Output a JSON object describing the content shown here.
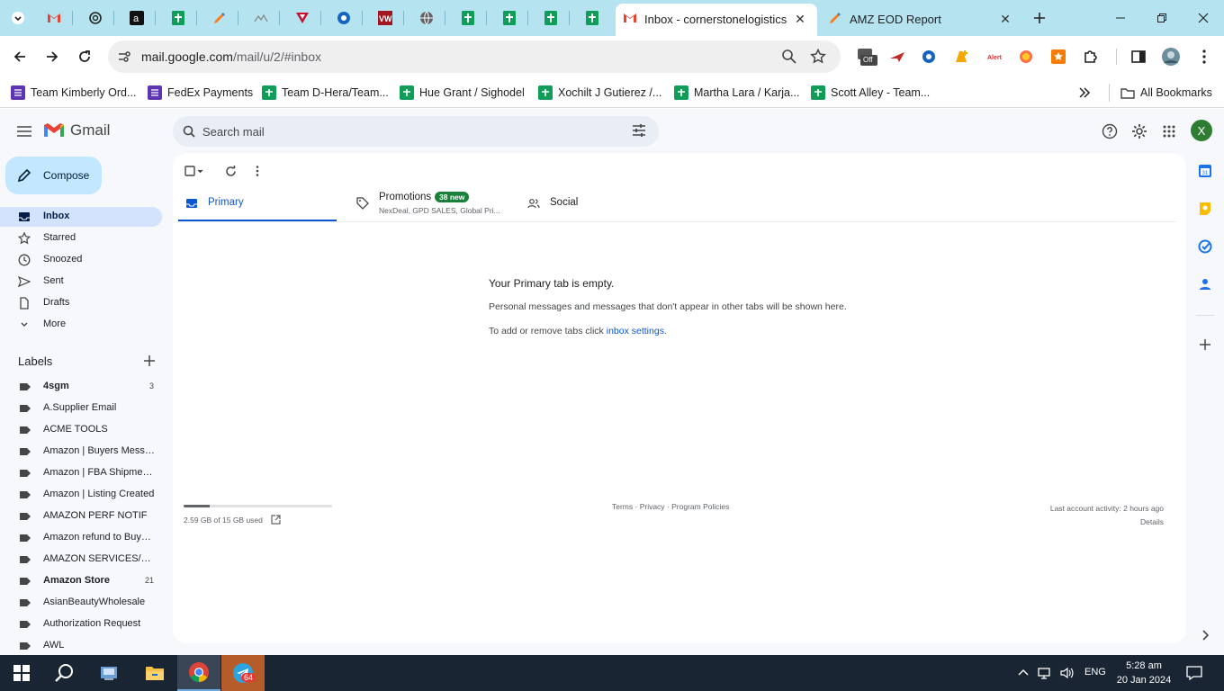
{
  "browser": {
    "active_tab_title": "Inbox - cornerstonelogisticsllc",
    "second_tab_title": "AMZ EOD Report",
    "url_host": "mail.google.com",
    "url_path": "/mail/u/2/#inbox",
    "bookmarks": [
      "Team Kimberly Ord...",
      "FedEx Payments",
      "Team D-Hera/Team...",
      "Hue Grant / Sighodel",
      "Xochilt J Gutierez /...",
      "Martha Lara / Karja...",
      "Scott Alley - Team..."
    ],
    "all_bookmarks": "All Bookmarks",
    "ext_off_label": "Off"
  },
  "gmail": {
    "logo_text": "Gmail",
    "search_placeholder": "Search mail",
    "avatar_letter": "X",
    "compose_label": "Compose",
    "nav": [
      "Inbox",
      "Starred",
      "Snoozed",
      "Sent",
      "Drafts",
      "More"
    ],
    "labels_heading": "Labels",
    "labels": [
      {
        "name": "4sgm",
        "count": "3",
        "bold": true
      },
      {
        "name": "A.Supplier Email",
        "count": "",
        "bold": false
      },
      {
        "name": "ACME TOOLS",
        "count": "",
        "bold": false
      },
      {
        "name": "Amazon | Buyers Messa...",
        "count": "",
        "bold": false
      },
      {
        "name": "Amazon | FBA Shipments",
        "count": "",
        "bold": false
      },
      {
        "name": "Amazon | Listing Created",
        "count": "",
        "bold": false
      },
      {
        "name": "AMAZON PERF NOTIF",
        "count": "",
        "bold": false
      },
      {
        "name": "Amazon refund to Buyers",
        "count": "",
        "bold": false
      },
      {
        "name": "AMAZON SERVICES/PAY...",
        "count": "",
        "bold": false
      },
      {
        "name": "Amazon Store",
        "count": "21",
        "bold": true
      },
      {
        "name": "AsianBeautyWholesale",
        "count": "",
        "bold": false
      },
      {
        "name": "Authorization Request",
        "count": "",
        "bold": false
      },
      {
        "name": "AWL",
        "count": "",
        "bold": false
      }
    ],
    "tabs": {
      "primary": "Primary",
      "promotions": "Promotions",
      "promotions_badge": "38 new",
      "promotions_sub": "NexDeal, GPD SALES, Global Pri...",
      "social": "Social"
    },
    "empty": {
      "title": "Your Primary tab is empty.",
      "line1": "Personal messages and messages that don't appear in other tabs will be shown here.",
      "line2_prefix": "To add or remove tabs click ",
      "line2_link": "inbox settings",
      "line2_suffix": "."
    },
    "storage_text": "2.59 GB of 15 GB used",
    "storage_fraction": 0.173,
    "footer_links": "Terms · Privacy · Program Policies",
    "last_activity": "Last account activity: 2 hours ago",
    "details": "Details"
  },
  "taskbar": {
    "chrome_badge": "64",
    "language": "ENG",
    "time": "5:28 am",
    "date": "20 Jan 2024"
  },
  "colors": {
    "tabstrip": "#b5e3f0",
    "compose": "#c2e7ff",
    "active_nav": "#d3e3fd",
    "accent": "#0b57d0"
  }
}
